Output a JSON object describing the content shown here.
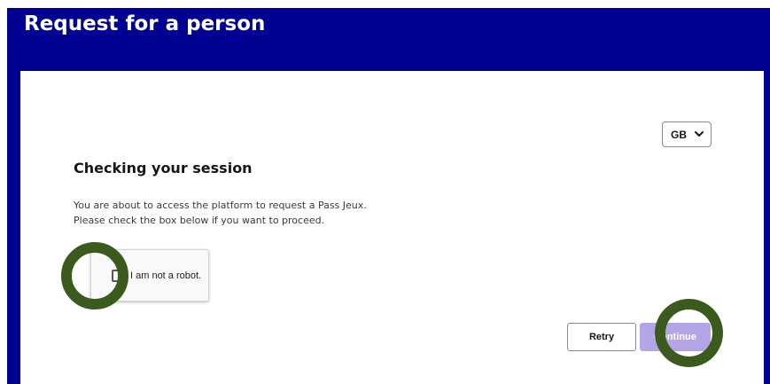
{
  "header": {
    "title": "Request for a person"
  },
  "card": {
    "language": {
      "selected": "GB",
      "icon": "chevron-down-icon"
    },
    "title": "Checking your session",
    "description_line1": "You are about to access the platform to request a Pass Jeux.",
    "description_line2": "Please check the box below if you want to proceed.",
    "captcha": {
      "label": "I am not a robot.",
      "checked": false
    },
    "buttons": {
      "retry": "Retry",
      "continue": "Continue"
    }
  },
  "colors": {
    "header_bg": "#000091",
    "continue_bg": "#b3a5e6",
    "highlight_ring": "#3b5a1e"
  }
}
